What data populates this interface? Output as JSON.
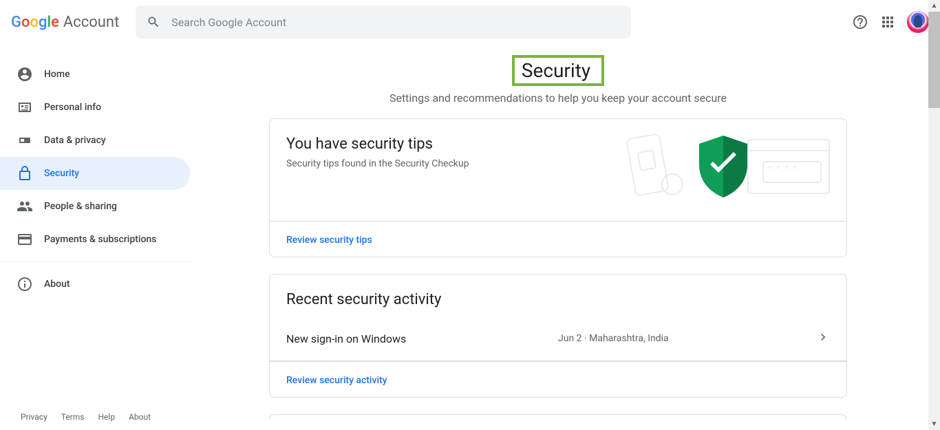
{
  "header": {
    "logo_account": "Account",
    "search_placeholder": "Search Google Account"
  },
  "sidebar": {
    "items": [
      {
        "label": "Home",
        "active": false
      },
      {
        "label": "Personal info",
        "active": false
      },
      {
        "label": "Data & privacy",
        "active": false
      },
      {
        "label": "Security",
        "active": true
      },
      {
        "label": "People & sharing",
        "active": false
      },
      {
        "label": "Payments & subscriptions",
        "active": false
      },
      {
        "label": "About",
        "active": false
      }
    ]
  },
  "footer": {
    "privacy": "Privacy",
    "terms": "Terms",
    "help": "Help",
    "about": "About"
  },
  "page": {
    "title": "Security",
    "subtitle": "Settings and recommendations to help you keep your account secure"
  },
  "tips_card": {
    "title": "You have security tips",
    "subtitle": "Security tips found in the Security Checkup",
    "action_label": "Review security tips"
  },
  "activity_card": {
    "title": "Recent security activity",
    "items": [
      {
        "title": "New sign-in on Windows",
        "meta": "Jun 2 · Maharashtra, India"
      }
    ],
    "action_label": "Review security activity"
  },
  "colors": {
    "accent": "#1a73e8",
    "highlight_border": "#7cb342",
    "shield": "#0f9d58"
  }
}
